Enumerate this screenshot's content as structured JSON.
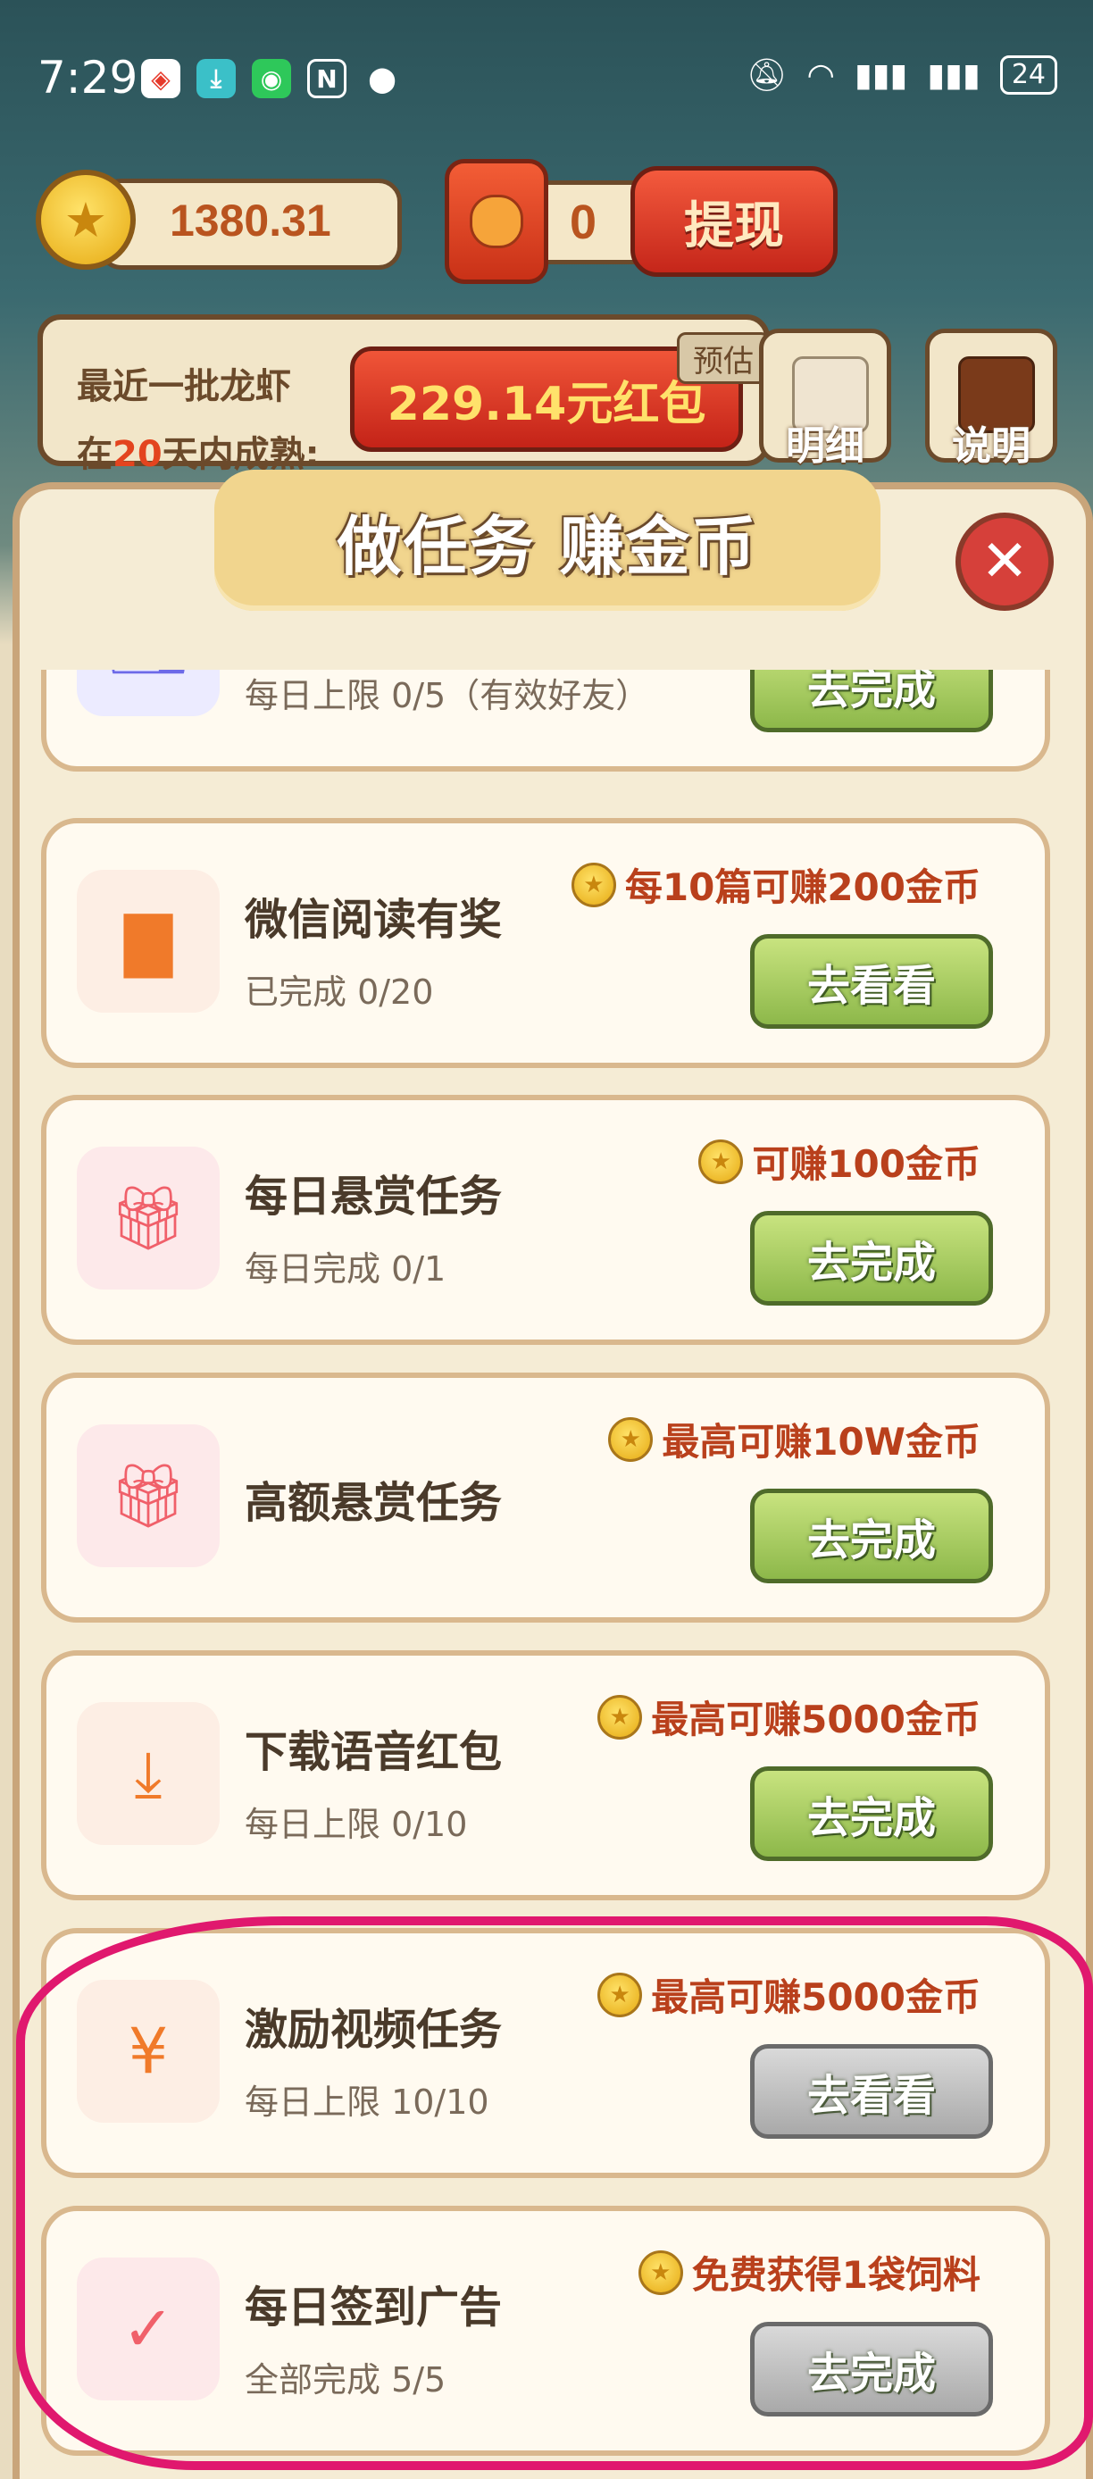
{
  "status_bar": {
    "time": "7:29",
    "battery": "24"
  },
  "top": {
    "coin_value": "1380.31",
    "redpacket_value": "0",
    "withdraw_label": "提现",
    "harvest_line1": "最近一批龙虾",
    "harvest_line2_prefix": "在",
    "harvest_days": "20",
    "harvest_line2_suffix": "天内成熟:",
    "harvest_amount": "229.14元红包",
    "estimate_label": "预估",
    "detail_label": "明细",
    "help_label": "说明"
  },
  "modal": {
    "title": "做任务 赚金币",
    "close_icon": "close-icon"
  },
  "tasks": [
    {
      "title": "",
      "sub": "每日上限 0/5（有效好友）",
      "reward": "",
      "button": "去完成",
      "icon": "friends-icon",
      "icon_bg": "#ecebff",
      "done": false
    },
    {
      "title": "微信阅读有奖",
      "sub": "已完成 0/20",
      "reward": "每10篇可赚200金币",
      "button": "去看看",
      "icon": "book-icon",
      "icon_bg": "#fdeee4",
      "done": false
    },
    {
      "title": "每日悬赏任务",
      "sub": "每日完成 0/1",
      "reward": "可赚100金币",
      "button": "去完成",
      "icon": "gift-icon",
      "icon_bg": "#fde9ea",
      "done": false
    },
    {
      "title": "高额悬赏任务",
      "sub": "",
      "reward": "最高可赚10W金币",
      "button": "去完成",
      "icon": "gift-icon",
      "icon_bg": "#fde9ea",
      "done": false
    },
    {
      "title": "下载语音红包",
      "sub": "每日上限 0/10",
      "reward": "最高可赚5000金币",
      "button": "去完成",
      "icon": "download-icon",
      "icon_bg": "#fdeee4",
      "done": false
    },
    {
      "title": "激励视频任务",
      "sub": "每日上限 10/10",
      "reward": "最高可赚5000金币",
      "button": "去看看",
      "icon": "yuan-icon",
      "icon_bg": "#fdeee4",
      "done": true
    },
    {
      "title": "每日签到广告",
      "sub": "全部完成 5/5",
      "reward": "免费获得1袋饲料",
      "button": "去完成",
      "icon": "calendar-check-icon",
      "icon_bg": "#fde9ea",
      "done": true
    }
  ],
  "colors": {
    "accent_red": "#b9401c",
    "button_green": "#8db84a",
    "highlight_ellipse": "#e0186e"
  }
}
